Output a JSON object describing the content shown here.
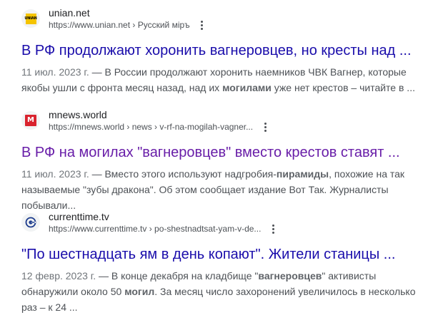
{
  "results": [
    {
      "site_name": "unian.net",
      "favicon_text": "UNIAN",
      "url": "https://www.unian.net › Русский мiръ",
      "title": "В РФ продолжают хоронить вагнеровцев, но кресты над ...",
      "date": "11 июл. 2023 г.",
      "dash": " — ",
      "snippet_a": "В России продолжают хоронить наемников ЧВК Вагнер, которые якобы ушли с фронта месяц назад, над их ",
      "snippet_b": "могилами",
      "snippet_c": " уже нет крестов – читайте в ..."
    },
    {
      "site_name": "mnews.world",
      "favicon_text": "M",
      "url": "https://mnews.world › news › v-rf-na-mogilah-vagner...",
      "title": "В РФ на могилах \"вагнеровцев\" вместо крестов ставят ...",
      "date": "11 июл. 2023 г.",
      "dash": " — ",
      "snippet_a": "Вместо этого используют надгробия-",
      "snippet_b": "пирамиды",
      "snippet_c": ", похожие на так называемые \"зубы дракона\". Об этом сообщает издание Вот Так. Журналисты побывали..."
    },
    {
      "site_name": "currenttime.tv",
      "url": "https://www.currenttime.tv › po-shestnadtsat-yam-v-de...",
      "title": "\"По шестнадцать ям в день копают\". Жители станицы ...",
      "date": "12 февр. 2023 г.",
      "dash": " — ",
      "snippet_a": "В конце декабря на кладбище \"",
      "snippet_b": "вагнеровцев",
      "snippet_c": "\" активисты обнаружили около 50 ",
      "snippet_d": "могил",
      "snippet_e": ". За месяц число захоронений увеличилось в несколько раз – к 24 ..."
    }
  ],
  "colors": {
    "link": "#1a0dab",
    "visited": "#681da8",
    "text": "#202124",
    "muted": "#4d5156"
  },
  "icons": {
    "unian": "unian-logo-icon",
    "mnews": "mnews-logo-icon",
    "currenttime": "currenttime-logo-icon",
    "menu": "more-vert-icon"
  }
}
